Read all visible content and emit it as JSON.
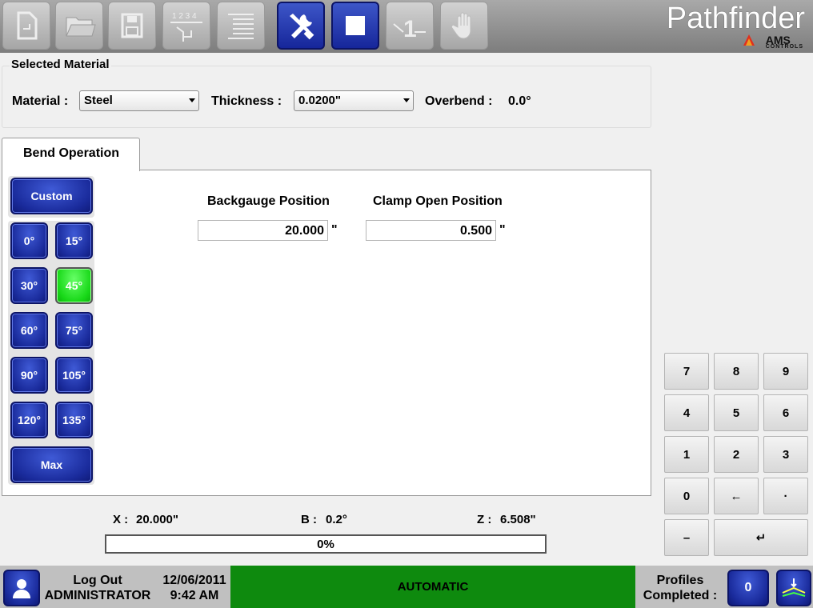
{
  "brand": {
    "name": "Pathfinder",
    "logo": "AMS",
    "logo_sub": "CONTROLS"
  },
  "toolbar": {
    "buttons": [
      {
        "icon": "new-file-icon"
      },
      {
        "icon": "open-folder-icon"
      },
      {
        "icon": "save-disk-icon"
      },
      {
        "icon": "bend-sequence-icon",
        "label": "1 2 3 4"
      },
      {
        "icon": "list-lines-icon"
      },
      {
        "icon": "tools-icon"
      },
      {
        "icon": "stop-icon"
      },
      {
        "icon": "single-step-icon",
        "label": "1"
      },
      {
        "icon": "hand-icon"
      }
    ]
  },
  "material": {
    "group_title": "Selected Material",
    "material_label": "Material :",
    "material_value": "Steel",
    "thickness_label": "Thickness :",
    "thickness_value": "0.0200\"",
    "overbend_label": "Overbend :",
    "overbend_value": "0.0°"
  },
  "bend": {
    "tab_label": "Bend Operation",
    "custom_label": "Custom",
    "max_label": "Max",
    "angles": [
      "0°",
      "15°",
      "30°",
      "45°",
      "60°",
      "75°",
      "90°",
      "105°",
      "120°",
      "135°"
    ],
    "selected_angle": "45°",
    "backgauge_label": "Backgauge Position",
    "backgauge_value": "20.000",
    "clamp_label": "Clamp Open Position",
    "clamp_value": "0.500",
    "unit": "\""
  },
  "status": {
    "x_label": "X :",
    "x_value": "20.000\"",
    "b_label": "B :",
    "b_value": "0.2°",
    "z_label": "Z :",
    "z_value": "6.508\"",
    "progress_text": "0%"
  },
  "keypad": {
    "keys": [
      "7",
      "8",
      "9",
      "4",
      "5",
      "6",
      "1",
      "2",
      "3",
      "0",
      "←",
      "·",
      "–",
      "↵"
    ]
  },
  "footer": {
    "logout_label": "Log Out",
    "user_name": "ADMINISTRATOR",
    "date": "12/06/2011",
    "time": "9:42 AM",
    "mode": "AUTOMATIC",
    "profiles_label_1": "Profiles",
    "profiles_label_2": "Completed :",
    "profiles_count": "0"
  },
  "colors": {
    "active_blue": "#1a2b9c",
    "selected_green": "#18d818",
    "mode_green": "#0e8a0e"
  }
}
